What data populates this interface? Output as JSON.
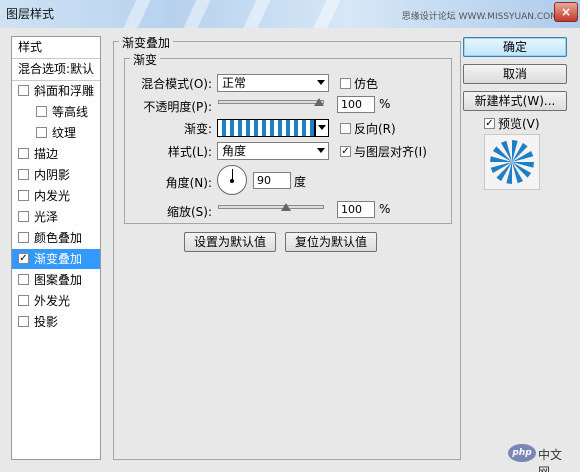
{
  "window": {
    "title": "图层样式",
    "watermark": "思缘设计论坛 WWW.MISSYUAN.COM",
    "close": "×"
  },
  "sidebar": {
    "header": "样式",
    "blend_options": "混合选项:默认",
    "items": [
      {
        "label": "斜面和浮雕",
        "checked": false
      },
      {
        "label": "等高线",
        "checked": false
      },
      {
        "label": "纹理",
        "checked": false
      },
      {
        "label": "描边",
        "checked": false
      },
      {
        "label": "内阴影",
        "checked": false
      },
      {
        "label": "内发光",
        "checked": false
      },
      {
        "label": "光泽",
        "checked": false
      },
      {
        "label": "颜色叠加",
        "checked": false
      },
      {
        "label": "渐变叠加",
        "checked": true
      },
      {
        "label": "图案叠加",
        "checked": false
      },
      {
        "label": "外发光",
        "checked": false
      },
      {
        "label": "投影",
        "checked": false
      }
    ]
  },
  "panel": {
    "group_title": "渐变叠加",
    "section_title": "渐变",
    "blend_mode_label": "混合模式(O):",
    "blend_mode_value": "正常",
    "dither_label": "仿色",
    "opacity_label": "不透明度(P):",
    "opacity_value": "100",
    "opacity_level": 100,
    "percent": "%",
    "gradient_label": "渐变:",
    "reverse_label": "反向(R)",
    "style_label": "样式(L):",
    "style_value": "角度",
    "align_label": "与图层对齐(I)",
    "angle_label": "角度(N):",
    "angle_value": "90",
    "degree": "度",
    "scale_label": "缩放(S):",
    "scale_value": "100",
    "scale_level": 100,
    "set_default": "设置为默认值",
    "reset_default": "复位为默认值",
    "colors": {
      "gradient_blue": "#1f7fc4",
      "selected": "#3399ff"
    }
  },
  "actions": {
    "ok": "确定",
    "cancel": "取消",
    "new_style": "新建样式(W)...",
    "preview": "预览(V)"
  },
  "logo": {
    "php": "php",
    "cn": "中文网"
  }
}
